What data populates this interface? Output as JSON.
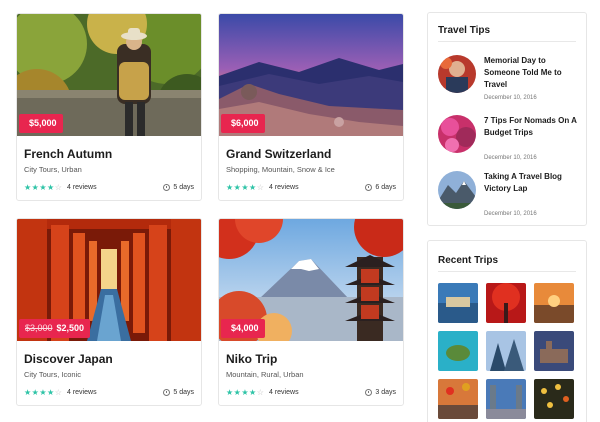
{
  "trips": [
    {
      "price": "$5,000",
      "old_price": "",
      "title": "French Autumn",
      "categories": "City Tours, Urban",
      "rating": 4,
      "reviews": "4 reviews",
      "duration": "5 days"
    },
    {
      "price": "$6,000",
      "old_price": "",
      "title": "Grand Switzerland",
      "categories": "Shopping, Mountain, Snow & Ice",
      "rating": 4,
      "reviews": "4 reviews",
      "duration": "6 days"
    },
    {
      "price": "$2,500",
      "old_price": "$3,000",
      "title": "Discover Japan",
      "categories": "City Tours, Iconic",
      "rating": 4,
      "reviews": "4 reviews",
      "duration": "5 days"
    },
    {
      "price": "$4,000",
      "old_price": "",
      "title": "Niko Trip",
      "categories": "Mountain, Rural, Urban",
      "rating": 4,
      "reviews": "4 reviews",
      "duration": "3 days"
    }
  ],
  "sidebar": {
    "travel_tips": {
      "title": "Travel Tips",
      "posts": [
        {
          "title": "Memorial Day to Someone Told Me to Travel",
          "date": "December 10, 2016"
        },
        {
          "title": "7 Tips For Nomads On A Budget Trips",
          "date": "December 10, 2016"
        },
        {
          "title": "Taking A Travel Blog Victory Lap",
          "date": "December 10, 2016"
        }
      ]
    },
    "recent_trips": {
      "title": "Recent Trips"
    }
  },
  "colors": {
    "price_badge": "#e8264f",
    "stars": "#2dc3a6"
  }
}
